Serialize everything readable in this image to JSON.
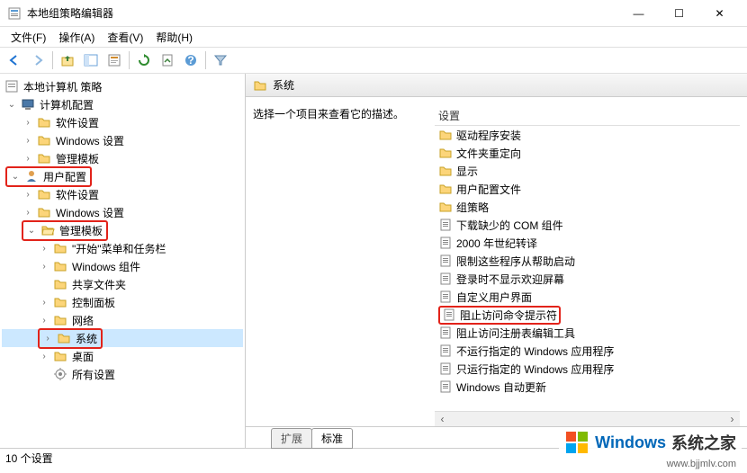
{
  "window": {
    "title": "本地组策略编辑器",
    "min": "—",
    "max": "☐",
    "close": "✕"
  },
  "menubar": {
    "file": "文件(F)",
    "action": "操作(A)",
    "view": "查看(V)",
    "help": "帮助(H)"
  },
  "tree": {
    "root": "本地计算机 策略",
    "computer_config": "计算机配置",
    "cc_software": "软件设置",
    "cc_windows": "Windows 设置",
    "cc_templates": "管理模板",
    "user_config": "用户配置",
    "uc_software": "软件设置",
    "uc_windows": "Windows 设置",
    "uc_templates": "管理模板",
    "start_taskbar": "\"开始\"菜单和任务栏",
    "win_components": "Windows 组件",
    "shared_folders": "共享文件夹",
    "control_panel": "控制面板",
    "network": "网络",
    "system": "系统",
    "desktop": "桌面",
    "all_settings": "所有设置"
  },
  "content": {
    "header": "系统",
    "description": "选择一个项目来查看它的描述。",
    "column": "设置",
    "items": [
      {
        "type": "folder",
        "label": "驱动程序安装"
      },
      {
        "type": "folder",
        "label": "文件夹重定向"
      },
      {
        "type": "folder",
        "label": "显示"
      },
      {
        "type": "folder",
        "label": "用户配置文件"
      },
      {
        "type": "folder",
        "label": "组策略"
      },
      {
        "type": "setting",
        "label": "下载缺少的 COM 组件"
      },
      {
        "type": "setting",
        "label": "2000 年世纪转译"
      },
      {
        "type": "setting",
        "label": "限制这些程序从帮助启动"
      },
      {
        "type": "setting",
        "label": "登录时不显示欢迎屏幕"
      },
      {
        "type": "setting",
        "label": "自定义用户界面"
      },
      {
        "type": "setting",
        "label": "阻止访问命令提示符",
        "highlight": true
      },
      {
        "type": "setting",
        "label": "阻止访问注册表编辑工具"
      },
      {
        "type": "setting",
        "label": "不运行指定的 Windows 应用程序"
      },
      {
        "type": "setting",
        "label": "只运行指定的 Windows 应用程序"
      },
      {
        "type": "setting",
        "label": "Windows 自动更新"
      }
    ],
    "tabs": {
      "extended": "扩展",
      "standard": "标准"
    }
  },
  "statusbar": {
    "text": "10 个设置"
  },
  "watermark": {
    "brand1": "Windows",
    "brand2": "系统之家",
    "url": "www.bjjmlv.com"
  }
}
